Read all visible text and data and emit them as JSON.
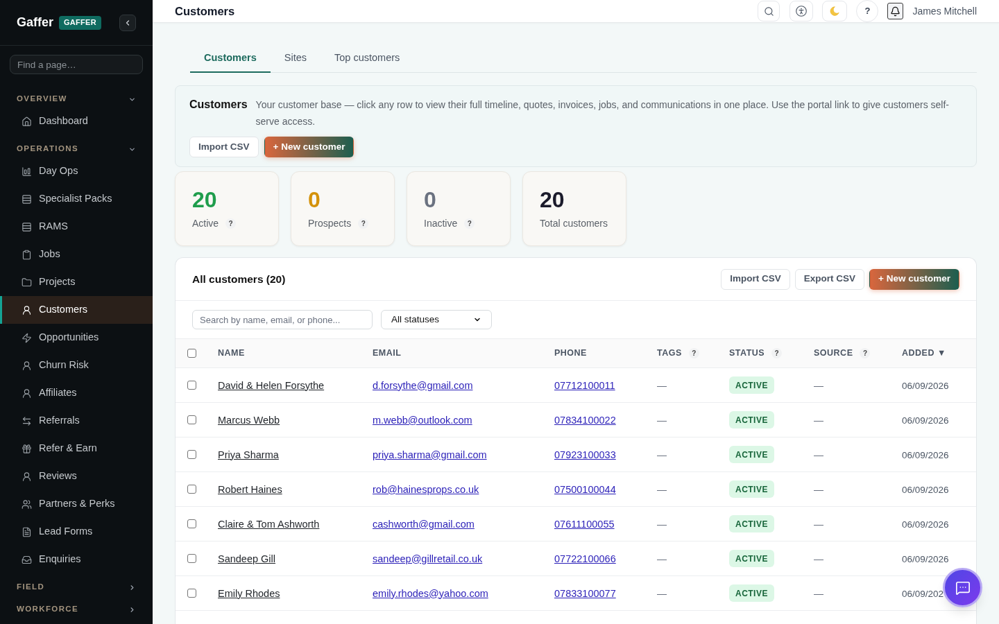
{
  "sidebar": {
    "logo": "Gaffer",
    "badge": "GAFFER",
    "search": {
      "placeholder": "Find a page…"
    },
    "sections": [
      {
        "label": "OVERVIEW",
        "expanded": true,
        "items": [
          {
            "label": "Dashboard",
            "selected": false
          }
        ]
      },
      {
        "label": "OPERATIONS",
        "expanded": true,
        "items": [
          {
            "label": "Day Ops",
            "selected": false
          },
          {
            "label": "Specialist Packs",
            "selected": false
          },
          {
            "label": "RAMS",
            "selected": false
          },
          {
            "label": "Jobs",
            "selected": false
          },
          {
            "label": "Projects",
            "selected": false
          },
          {
            "label": "Customers",
            "selected": true
          },
          {
            "label": "Opportunities",
            "selected": false
          },
          {
            "label": "Churn Risk",
            "selected": false
          },
          {
            "label": "Affiliates",
            "selected": false
          },
          {
            "label": "Referrals",
            "selected": false
          },
          {
            "label": "Refer & Earn",
            "selected": false
          },
          {
            "label": "Reviews",
            "selected": false
          },
          {
            "label": "Partners & Perks",
            "selected": false
          },
          {
            "label": "Lead Forms",
            "selected": false
          },
          {
            "label": "Enquiries",
            "selected": false
          }
        ]
      },
      {
        "label": "FIELD",
        "expanded": false
      },
      {
        "label": "WORKFORCE",
        "expanded": false
      }
    ]
  },
  "top_bar": {
    "title": "Customers",
    "help": "?",
    "user": "James Mitchell"
  },
  "tabs": [
    {
      "label": "Customers",
      "selected": true
    },
    {
      "label": "Sites",
      "selected": false
    },
    {
      "label": "Top customers",
      "selected": false
    }
  ],
  "intro": {
    "title": "Customers",
    "description": "Your customer base — click any row to view their full timeline, quotes, invoices, jobs, and communications in one place. Use the portal link to give customers self-serve access.",
    "buttons": [
      {
        "label": "Import CSV",
        "kind": "secondary"
      },
      {
        "label": "+ New customer",
        "kind": "primary"
      }
    ]
  },
  "stats": [
    {
      "value": "20",
      "label": "Active",
      "help": "?",
      "color": "#1f9d4c"
    },
    {
      "value": "0",
      "label": "Prospects",
      "help": "?",
      "color": "#d4920b"
    },
    {
      "value": "0",
      "label": "Inactive",
      "help": "?",
      "color": "#6b7280"
    },
    {
      "value": "20",
      "label": "Total customers",
      "color": "#1b1b2b"
    }
  ],
  "table": {
    "title": "All customers (20)",
    "buttons": [
      {
        "label": "Import CSV",
        "kind": "secondary"
      },
      {
        "label": "Export CSV",
        "kind": "secondary"
      },
      {
        "label": "+ New customer",
        "kind": "primary"
      }
    ],
    "search": {
      "placeholder": "Search by name, email, or phone..."
    },
    "status_filter": {
      "value": "All statuses"
    },
    "select_all": {
      "checked": false
    },
    "columns": [
      {
        "label": "NAME"
      },
      {
        "label": "EMAIL"
      },
      {
        "label": "PHONE"
      },
      {
        "label": "TAGS",
        "help": "?"
      },
      {
        "label": "STATUS",
        "help": "?"
      },
      {
        "label": "SOURCE",
        "help": "?"
      },
      {
        "label": "ADDED ▼"
      }
    ],
    "rows": [
      {
        "checked": false,
        "name": "David & Helen Forsythe",
        "email": "d.forsythe@gmail.com",
        "phone": "07712100011",
        "tags": "—",
        "status": "ACTIVE",
        "source": "—",
        "added": "06/09/2026"
      },
      {
        "checked": false,
        "name": "Marcus Webb",
        "email": "m.webb@outlook.com",
        "phone": "07834100022",
        "tags": "—",
        "status": "ACTIVE",
        "source": "—",
        "added": "06/09/2026"
      },
      {
        "checked": false,
        "name": "Priya Sharma",
        "email": "priya.sharma@gmail.com",
        "phone": "07923100033",
        "tags": "—",
        "status": "ACTIVE",
        "source": "—",
        "added": "06/09/2026"
      },
      {
        "checked": false,
        "name": "Robert Haines",
        "email": "rob@hainesprops.co.uk",
        "phone": "07500100044",
        "tags": "—",
        "status": "ACTIVE",
        "source": "—",
        "added": "06/09/2026"
      },
      {
        "checked": false,
        "name": "Claire & Tom Ashworth",
        "email": "cashworth@gmail.com",
        "phone": "07611100055",
        "tags": "—",
        "status": "ACTIVE",
        "source": "—",
        "added": "06/09/2026"
      },
      {
        "checked": false,
        "name": "Sandeep Gill",
        "email": "sandeep@gillretail.co.uk",
        "phone": "07722100066",
        "tags": "—",
        "status": "ACTIVE",
        "source": "—",
        "added": "06/09/2026"
      },
      {
        "checked": false,
        "name": "Emily Rhodes",
        "email": "emily.rhodes@yahoo.com",
        "phone": "07833100077",
        "tags": "—",
        "status": "ACTIVE",
        "source": "—",
        "added": "06/09/202"
      }
    ]
  }
}
